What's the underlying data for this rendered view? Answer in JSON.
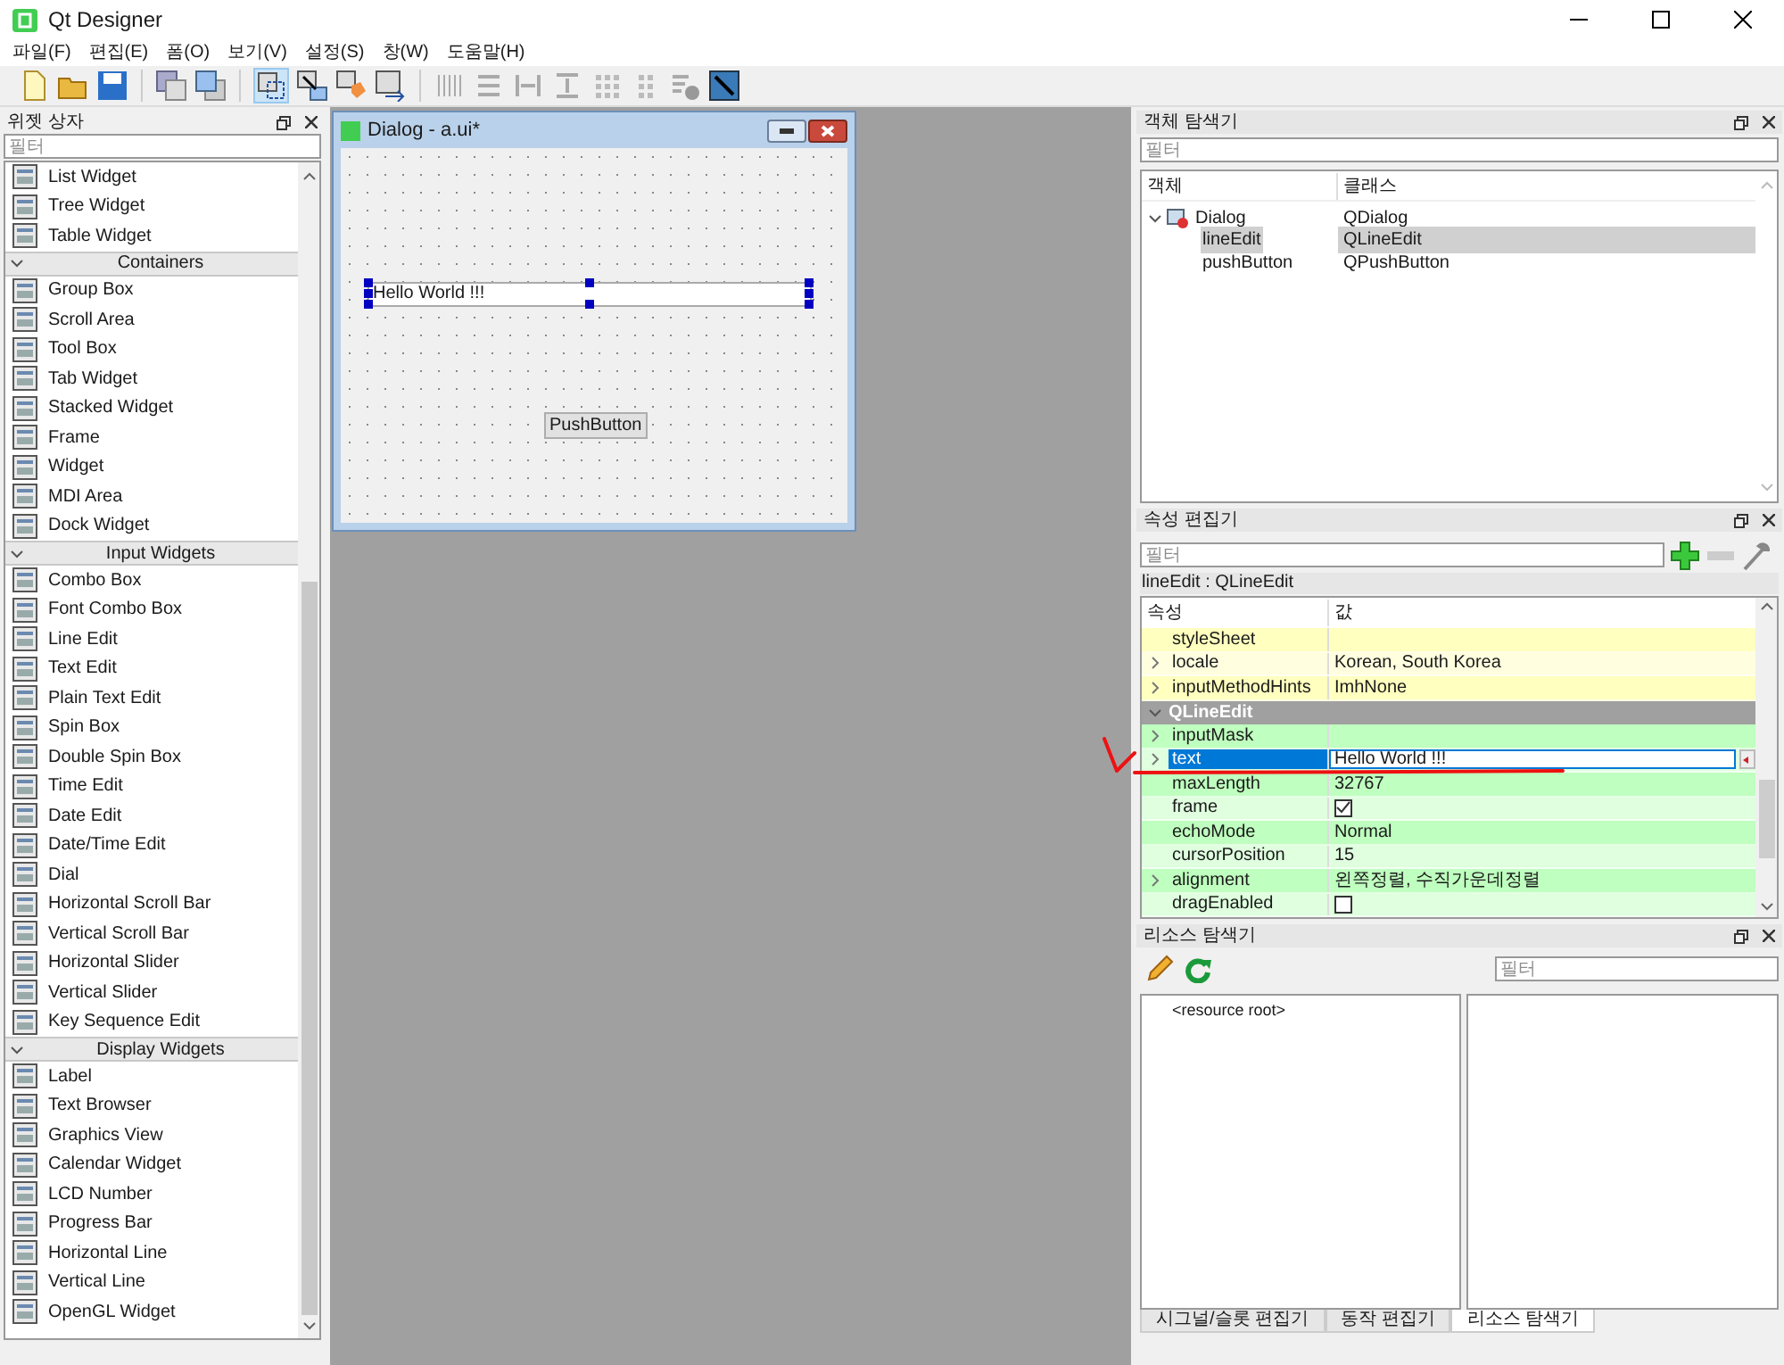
{
  "window": {
    "title": "Qt Designer"
  },
  "menu": [
    "파일(F)",
    "편집(E)",
    "폼(O)",
    "보기(V)",
    "설정(S)",
    "창(W)",
    "도움말(H)"
  ],
  "widget_box": {
    "title": "위젯 상자",
    "filter": {
      "placeholder": "필터"
    },
    "rows": [
      {
        "kind": "item",
        "label": "List Widget"
      },
      {
        "kind": "item",
        "label": "Tree Widget"
      },
      {
        "kind": "item",
        "label": "Table Widget"
      },
      {
        "kind": "category",
        "label": "Containers"
      },
      {
        "kind": "item",
        "label": "Group Box"
      },
      {
        "kind": "item",
        "label": "Scroll Area"
      },
      {
        "kind": "item",
        "label": "Tool Box"
      },
      {
        "kind": "item",
        "label": "Tab Widget"
      },
      {
        "kind": "item",
        "label": "Stacked Widget"
      },
      {
        "kind": "item",
        "label": "Frame"
      },
      {
        "kind": "item",
        "label": "Widget"
      },
      {
        "kind": "item",
        "label": "MDI Area"
      },
      {
        "kind": "item",
        "label": "Dock Widget"
      },
      {
        "kind": "category",
        "label": "Input Widgets"
      },
      {
        "kind": "item",
        "label": "Combo Box"
      },
      {
        "kind": "item",
        "label": "Font Combo Box"
      },
      {
        "kind": "item",
        "label": "Line Edit"
      },
      {
        "kind": "item",
        "label": "Text Edit"
      },
      {
        "kind": "item",
        "label": "Plain Text Edit"
      },
      {
        "kind": "item",
        "label": "Spin Box"
      },
      {
        "kind": "item",
        "label": "Double Spin Box"
      },
      {
        "kind": "item",
        "label": "Time Edit"
      },
      {
        "kind": "item",
        "label": "Date Edit"
      },
      {
        "kind": "item",
        "label": "Date/Time Edit"
      },
      {
        "kind": "item",
        "label": "Dial"
      },
      {
        "kind": "item",
        "label": "Horizontal Scroll Bar"
      },
      {
        "kind": "item",
        "label": "Vertical Scroll Bar"
      },
      {
        "kind": "item",
        "label": "Horizontal Slider"
      },
      {
        "kind": "item",
        "label": "Vertical Slider"
      },
      {
        "kind": "item",
        "label": "Key Sequence Edit"
      },
      {
        "kind": "category",
        "label": "Display Widgets"
      },
      {
        "kind": "item",
        "label": "Label"
      },
      {
        "kind": "item",
        "label": "Text Browser"
      },
      {
        "kind": "item",
        "label": "Graphics View"
      },
      {
        "kind": "item",
        "label": "Calendar Widget"
      },
      {
        "kind": "item",
        "label": "LCD Number"
      },
      {
        "kind": "item",
        "label": "Progress Bar"
      },
      {
        "kind": "item",
        "label": "Horizontal Line"
      },
      {
        "kind": "item",
        "label": "Vertical Line"
      },
      {
        "kind": "item",
        "label": "OpenGL Widget"
      }
    ]
  },
  "form": {
    "title": "Dialog - a.ui*",
    "line_edit": {
      "value": "Hello World !!!",
      "selected": true
    },
    "button": "PushButton"
  },
  "object_inspector": {
    "title": "객체 탐색기",
    "filter": {
      "placeholder": "필터"
    },
    "columns": [
      "객체",
      "클래스"
    ],
    "tree": [
      {
        "name": "Dialog",
        "class": "QDialog",
        "expanded": true,
        "selected": false,
        "children": [
          {
            "name": "lineEdit",
            "class": "QLineEdit",
            "selected": true
          },
          {
            "name": "pushButton",
            "class": "QPushButton",
            "selected": false
          }
        ]
      }
    ]
  },
  "property_editor": {
    "title": "속성 편집기",
    "filter": {
      "placeholder": "필터"
    },
    "object_label": "lineEdit : QLineEdit",
    "columns": [
      "속성",
      "값"
    ],
    "rows": [
      {
        "kind": "text",
        "name": "styleSheet",
        "value": "",
        "expandable": false,
        "color": "#ffffbf"
      },
      {
        "kind": "text",
        "name": "locale",
        "value": "Korean, South Korea",
        "expandable": true,
        "color": "#ffffdf"
      },
      {
        "kind": "text",
        "name": "inputMethodHints",
        "value": "ImhNone",
        "expandable": true,
        "color": "#ffffbf"
      },
      {
        "kind": "category",
        "name": "QLineEdit",
        "expanded": true
      },
      {
        "kind": "text",
        "name": "inputMask",
        "value": "",
        "expandable": true,
        "color": "#bfffbf"
      },
      {
        "kind": "edit",
        "name": "text",
        "value": "Hello World !!!",
        "expandable": true,
        "selected": true,
        "color": "#dfffdf"
      },
      {
        "kind": "text",
        "name": "maxLength",
        "value": "32767",
        "expandable": false,
        "color": "#bfffbf"
      },
      {
        "kind": "checkbox",
        "name": "frame",
        "checked": true,
        "expandable": false,
        "color": "#dfffdf"
      },
      {
        "kind": "text",
        "name": "echoMode",
        "value": "Normal",
        "expandable": false,
        "color": "#bfffbf"
      },
      {
        "kind": "text",
        "name": "cursorPosition",
        "value": "15",
        "expandable": false,
        "color": "#dfffdf"
      },
      {
        "kind": "text",
        "name": "alignment",
        "value": "왼쪽정렬, 수직가운데정렬",
        "expandable": true,
        "color": "#bfffbf"
      },
      {
        "kind": "checkbox",
        "name": "dragEnabled",
        "checked": false,
        "expandable": false,
        "color": "#dfffdf"
      }
    ]
  },
  "resource_browser": {
    "title": "리소스 탐색기",
    "filter": {
      "placeholder": "필터"
    },
    "tree": [
      "<resource root>"
    ]
  },
  "bottom_tabs": [
    {
      "label": "시그널/슬롯 편집기",
      "selected": false
    },
    {
      "label": "동작 편집기",
      "selected": false
    },
    {
      "label": "리소스 탐색기",
      "selected": true
    }
  ]
}
